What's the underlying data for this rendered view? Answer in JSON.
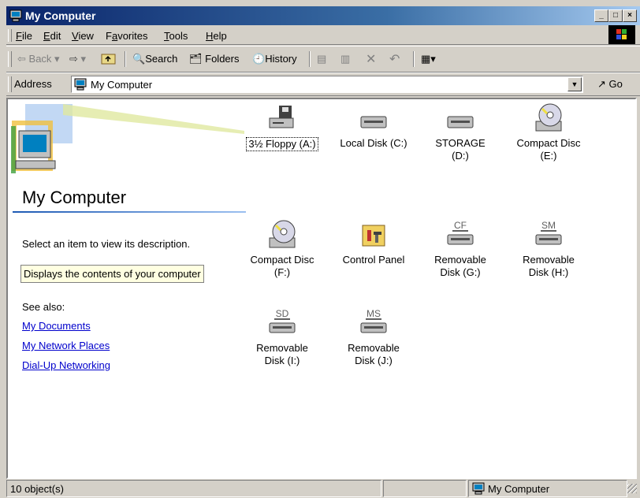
{
  "window": {
    "title": "My Computer"
  },
  "menubar": {
    "items": [
      {
        "label": "File",
        "u": "F",
        "rest": "ile"
      },
      {
        "label": "Edit",
        "u": "E",
        "rest": "dit"
      },
      {
        "label": "View",
        "u": "V",
        "rest": "iew"
      },
      {
        "label": "Favorites",
        "pre": "F",
        "u": "a",
        "rest": "vorites"
      },
      {
        "label": "Tools",
        "u": "T",
        "rest": "ools"
      },
      {
        "label": "Help",
        "u": "H",
        "rest": "elp"
      }
    ]
  },
  "toolbar": {
    "back_label": "Back",
    "search_label": "Search",
    "folders_label": "Folders",
    "history_label": "History",
    "delete_glyph": "✕",
    "undo_glyph": "↶"
  },
  "address": {
    "label": "Address",
    "value": "My Computer",
    "go_label": "Go"
  },
  "left_pane": {
    "title": "My Computer",
    "hint": "Select an item to view its description.",
    "description": "Displays the contents of your computer",
    "see_also": "See also:",
    "links": [
      "My Documents",
      "My Network Places",
      "Dial-Up Networking"
    ]
  },
  "items": [
    {
      "label": "3½ Floppy (A:)",
      "icon": "floppy-drive-icon"
    },
    {
      "label": "Local Disk (C:)",
      "icon": "hard-disk-icon"
    },
    {
      "label": "STORAGE\n(D:)",
      "icon": "hard-disk-icon"
    },
    {
      "label": "Compact Disc\n(E:)",
      "icon": "cd-drive-icon"
    },
    {
      "label": "Compact Disc\n(F:)",
      "icon": "cd-drive-icon"
    },
    {
      "label": "Control Panel",
      "icon": "control-panel-icon"
    },
    {
      "label": "Removable\nDisk (G:)",
      "icon": "removable-disk-icon",
      "tag": "CF"
    },
    {
      "label": "Removable\nDisk (H:)",
      "icon": "removable-disk-icon",
      "tag": "SM"
    },
    {
      "label": "Removable\nDisk (I:)",
      "icon": "removable-disk-icon",
      "tag": "SD"
    },
    {
      "label": "Removable\nDisk (J:)",
      "icon": "removable-disk-icon",
      "tag": "MS"
    }
  ],
  "status": {
    "count": "10 object(s)",
    "zone": "My Computer"
  },
  "colors": {
    "titlebar_start": "#0a246a",
    "titlebar_end": "#a6caf0",
    "link": "#0000cc",
    "desc_bg": "#ffffe1"
  }
}
